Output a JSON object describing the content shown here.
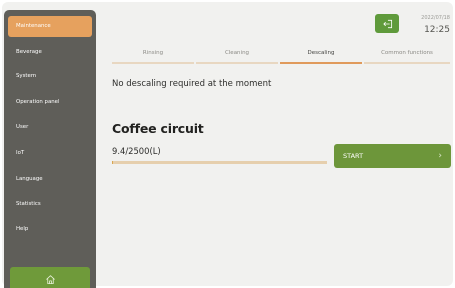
{
  "sidebar": {
    "items": [
      {
        "label": "Maintenance",
        "active": true
      },
      {
        "label": "Beverage",
        "active": false
      },
      {
        "label": "System",
        "active": false
      },
      {
        "label": "Operation panel",
        "active": false
      },
      {
        "label": "User",
        "active": false
      },
      {
        "label": "IoT",
        "active": false
      },
      {
        "label": "Language",
        "active": false
      },
      {
        "label": "Statistics",
        "active": false
      },
      {
        "label": "Help",
        "active": false
      }
    ],
    "home_icon": "home-icon"
  },
  "header": {
    "exit_icon": "exit-icon",
    "date": "2022/07/18",
    "time": "12:25"
  },
  "tabs": [
    {
      "label": "Rinsing",
      "active": false
    },
    {
      "label": "Cleaning",
      "active": false
    },
    {
      "label": "Descaling",
      "active": true
    },
    {
      "label": "Common functions",
      "active": false
    }
  ],
  "main": {
    "message": "No descaling required at the moment",
    "circuit_title": "Coffee circuit",
    "count": "9.4/2500(L)",
    "progress_fraction": 0.004,
    "start_label": "START",
    "start_chevron": "›"
  },
  "colors": {
    "sidebar_bg": "#5f5e59",
    "active_orange": "#e6a15e",
    "green": "#6d963a",
    "progress_track": "#e6cfad"
  }
}
